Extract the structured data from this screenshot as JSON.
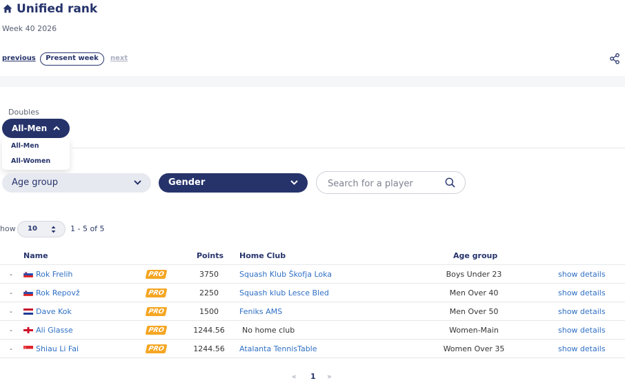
{
  "header": {
    "title": "Unified rank",
    "week": "Week 40 2026"
  },
  "nav": {
    "previous": "previous",
    "present": "Present week",
    "next": "next"
  },
  "doubles": {
    "label": "Doubles",
    "selected": "All-Men",
    "options": [
      "All-Men",
      "All-Women"
    ]
  },
  "filters": {
    "age_group": "Age group",
    "gender": "Gender",
    "search_placeholder": "Search for a player"
  },
  "pagination_info": {
    "show_label": "how",
    "page_size": "10",
    "range": "1 - 5 of 5"
  },
  "table": {
    "headers": {
      "name": "Name",
      "points": "Points",
      "home_club": "Home Club",
      "age_group": "Age group"
    },
    "rows": [
      {
        "dash": "-",
        "flag": "slovenia-flag",
        "name": "Rok Frelih",
        "badge": "PRO",
        "points": "3750",
        "club": "Squash Klub Škofja Loka",
        "age_group": "Boys Under 23",
        "action": "show details"
      },
      {
        "dash": "-",
        "flag": "slovenia-flag",
        "name": "Rok Repovž",
        "badge": "PRO",
        "points": "2250",
        "club": "Squash klub Lesce Bled",
        "age_group": "Men Over 40",
        "action": "show details"
      },
      {
        "dash": "-",
        "flag": "netherlands-flag",
        "name": "Dave Kok",
        "badge": "PRO",
        "points": "1500",
        "club": "Feniks AMS",
        "age_group": "Men Over 50",
        "action": "show details"
      },
      {
        "dash": "-",
        "flag": "england-flag",
        "name": "Ali Glasse",
        "badge": "PRO",
        "points": "1244.56",
        "club": "No home club",
        "age_group": "Women-Main",
        "action": "show details"
      },
      {
        "dash": "-",
        "flag": "singapore-flag",
        "name": "Shiau Li Fai",
        "badge": "PRO",
        "points": "1244.56",
        "club": "Atalanta TennisTable",
        "age_group": "Women Over 35",
        "action": "show details"
      }
    ]
  },
  "pager": {
    "prev": "«",
    "current": "1",
    "next": "»"
  },
  "colors": {
    "primary": "#26336b",
    "link": "#2e6fc4",
    "pro_badge": "#f5a623"
  }
}
